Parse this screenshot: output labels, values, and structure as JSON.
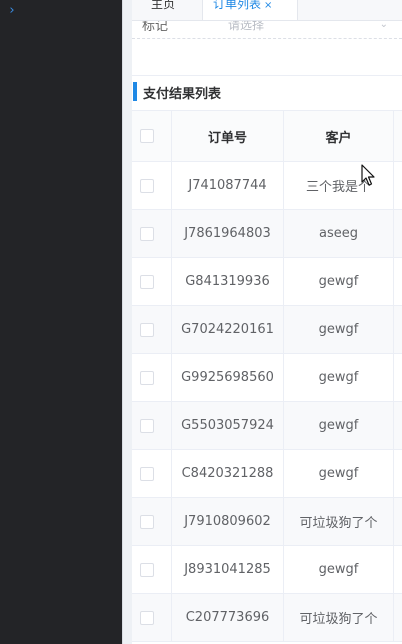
{
  "sidebar": {
    "collapse_icon": "chevron-right-icon",
    "collapse_glyph": "›",
    "background": "#232427"
  },
  "tabs": [
    {
      "label": "主页"
    },
    {
      "label": "订单列表",
      "close_glyph": "×",
      "active": true
    }
  ],
  "filter": {
    "label": "标记",
    "placeholder": "请选择"
  },
  "section": {
    "title": "支付结果列表",
    "accent_color": "#1e88e5"
  },
  "table": {
    "columns": [
      "订单号",
      "客户"
    ],
    "rows": [
      {
        "order_no": "J741087744",
        "customer": "三个我是个"
      },
      {
        "order_no": "J7861964803",
        "customer": "aseeg"
      },
      {
        "order_no": "G841319936",
        "customer": "gewgf"
      },
      {
        "order_no": "G7024220161",
        "customer": "gewgf"
      },
      {
        "order_no": "G9925698560",
        "customer": "gewgf"
      },
      {
        "order_no": "G5503057924",
        "customer": "gewgf"
      },
      {
        "order_no": "C8420321288",
        "customer": "gewgf"
      },
      {
        "order_no": "J7910809602",
        "customer": "可垃圾狗了个"
      },
      {
        "order_no": "J8931041285",
        "customer": "gewgf"
      },
      {
        "order_no": "C207773696",
        "customer": "可垃圾狗了个"
      }
    ]
  }
}
